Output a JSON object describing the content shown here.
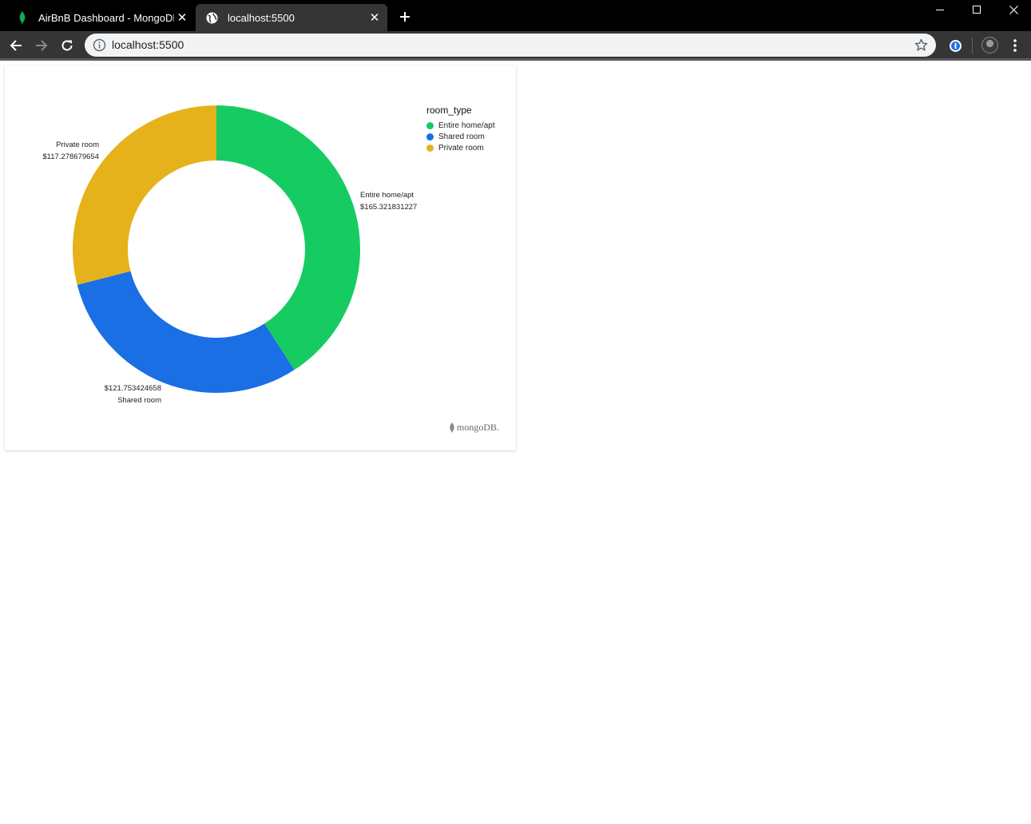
{
  "browser": {
    "tabs": [
      {
        "title": "AirBnB Dashboard - MongoDB Cl",
        "active": false,
        "favicon": "mongodb-leaf-icon"
      },
      {
        "title": "localhost:5500",
        "active": true,
        "favicon": "globe-icon"
      }
    ],
    "address": "localhost:5500"
  },
  "legend": {
    "title": "room_type",
    "items": [
      {
        "label": "Entire home/apt",
        "color": "#16cc62"
      },
      {
        "label": "Shared room",
        "color": "#196fe3"
      },
      {
        "label": "Private room",
        "color": "#e5b21b"
      }
    ]
  },
  "chart_data": {
    "type": "pie",
    "donut": true,
    "categories": [
      "Entire home/apt",
      "Shared room",
      "Private room"
    ],
    "values": [
      165.321831227,
      121.753424658,
      117.278679654
    ],
    "data_labels": [
      {
        "category": "Entire home/apt",
        "value": "$165.321831227"
      },
      {
        "category": "Shared room",
        "value": "$121.753424658"
      },
      {
        "category": "Private room",
        "value": "$117.278679654"
      }
    ],
    "colors": [
      "#16cc62",
      "#196fe3",
      "#e5b21b"
    ],
    "legend": "top-right"
  },
  "branding": {
    "logo_text": "mongoDB."
  }
}
